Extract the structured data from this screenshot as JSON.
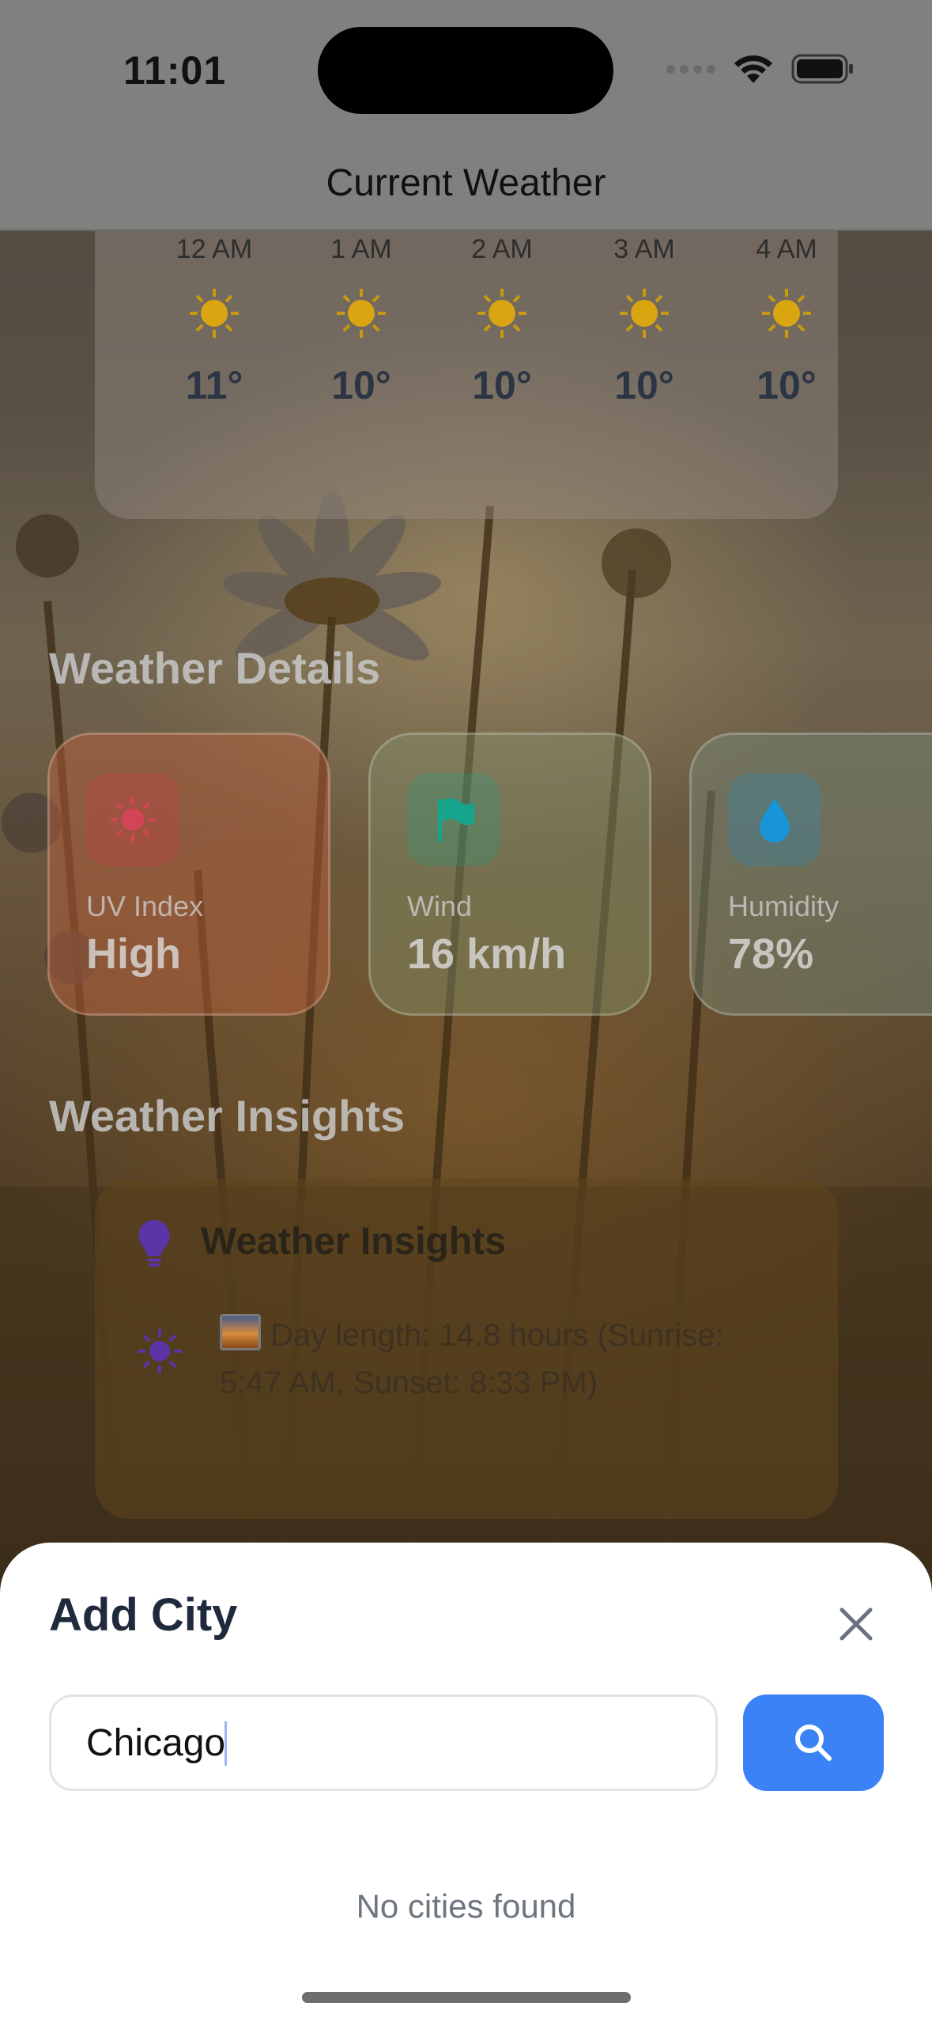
{
  "status_bar": {
    "time": "11:01"
  },
  "nav": {
    "title": "Current Weather"
  },
  "hourly": [
    {
      "time": "12 AM",
      "icon": "sun-icon",
      "temp": "11°"
    },
    {
      "time": "1 AM",
      "icon": "sun-icon",
      "temp": "10°"
    },
    {
      "time": "2 AM",
      "icon": "sun-icon",
      "temp": "10°"
    },
    {
      "time": "3 AM",
      "icon": "sun-icon",
      "temp": "10°"
    },
    {
      "time": "4 AM",
      "icon": "sun-icon",
      "temp": "10°"
    }
  ],
  "details": {
    "title": "Weather Details",
    "cards": [
      {
        "label": "UV Index",
        "value": "High",
        "icon": "sun-icon",
        "color": "#e0334a"
      },
      {
        "label": "Wind",
        "value": "16 km/h",
        "icon": "flag-icon",
        "color": "#14a38b"
      },
      {
        "label": "Humidity",
        "value": "78%",
        "icon": "water-drop-icon",
        "color": "#1795d6"
      }
    ]
  },
  "insights": {
    "section_title": "Weather Insights",
    "card_title": "Weather Insights",
    "items": [
      {
        "icon": "sun-icon",
        "text": "Day length: 14.8 hours (Sunrise: 5:47 AM, Sunset: 8:33 PM)"
      }
    ]
  },
  "add_city": {
    "title": "Add City",
    "search_value": "Chicago",
    "empty_message": "No cities found"
  },
  "colors": {
    "accent": "#3b82f6",
    "sheet_title": "#1f2a3c",
    "insight_icon": "#6b3fc4"
  }
}
